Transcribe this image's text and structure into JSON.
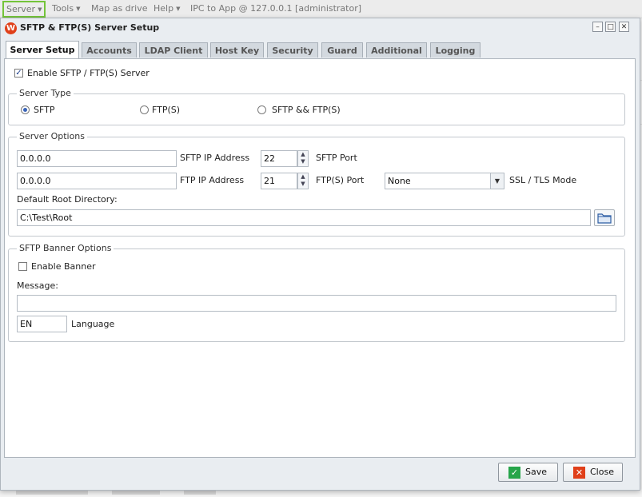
{
  "menu": {
    "server": "Server",
    "tools": "Tools",
    "map_drive": "Map as drive",
    "help": "Help",
    "ipc": "IPC to App @ 127.0.0.1 [administrator]"
  },
  "dialog": {
    "title": "SFTP & FTP(S) Server Setup",
    "logo_letter": "W",
    "accent_color": "#74c43a"
  },
  "tabs": [
    "Server Setup",
    "Accounts",
    "LDAP Client",
    "Host Key",
    "Security",
    "Guard",
    "Additional",
    "Logging"
  ],
  "enable_server": {
    "label": "Enable SFTP / FTP(S) Server",
    "checked": true
  },
  "server_type": {
    "legend": "Server Type",
    "options": [
      "SFTP",
      "FTP(S)",
      "SFTP && FTP(S)"
    ],
    "selected": "SFTP"
  },
  "server_options": {
    "legend": "Server Options",
    "sftp_ip": "0.0.0.0",
    "sftp_ip_label": "SFTP IP Address",
    "sftp_port": "22",
    "sftp_port_label": "SFTP Port",
    "ftp_ip": "0.0.0.0",
    "ftp_ip_label": "FTP IP Address",
    "ftp_port": "21",
    "ftp_port_label": "FTP(S) Port",
    "ssl_mode": "None",
    "ssl_mode_label": "SSL / TLS Mode",
    "root_dir_label": "Default Root Directory:",
    "root_dir": "C:\\Test\\Root"
  },
  "banner": {
    "legend": "SFTP Banner Options",
    "enable_label": "Enable Banner",
    "enabled": false,
    "message_label": "Message:",
    "message": "",
    "language": "EN",
    "language_label": "Language"
  },
  "footer": {
    "save": "Save",
    "close": "Close"
  }
}
